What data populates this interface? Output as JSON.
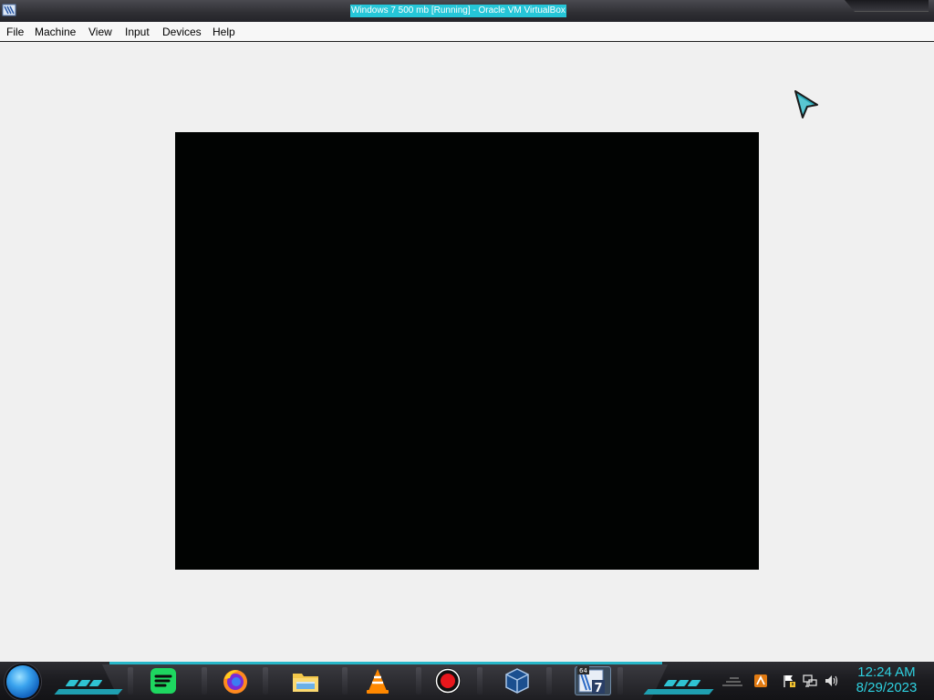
{
  "window": {
    "title": "Windows 7 500 mb [Running] - Oracle VM VirtualBox",
    "app_icon": "virtualbox-icon"
  },
  "menubar": {
    "items": [
      "File",
      "Machine",
      "View",
      "Input",
      "Devices",
      "Help"
    ]
  },
  "vm_display": {
    "state": "black screen",
    "background": "#010302"
  },
  "taskbar": {
    "start_button": "windows-orb",
    "pinned_apps": [
      {
        "name": "Spotify",
        "icon": "spotify-icon"
      },
      {
        "name": "Firefox",
        "icon": "firefox-icon"
      },
      {
        "name": "File Explorer",
        "icon": "folder-icon"
      },
      {
        "name": "VLC",
        "icon": "vlc-icon"
      },
      {
        "name": "Screen Recorder",
        "icon": "record-icon"
      },
      {
        "name": "VirtualBox",
        "icon": "virtualbox-icon"
      },
      {
        "name": "Windows 7 VM",
        "icon": "windows7-vm-icon",
        "badge": "64",
        "number": "7"
      }
    ],
    "tray": {
      "icons": [
        "show-desktop-icon",
        "app-tray-icon",
        "action-center-flag-icon",
        "network-icon",
        "volume-icon"
      ]
    },
    "clock": {
      "time": "12:24 AM",
      "date": "8/29/2023"
    }
  },
  "colors": {
    "accent": "#2ed1e0",
    "title_highlight": "#25c6d8",
    "taskbar": "#1b1b1f"
  }
}
